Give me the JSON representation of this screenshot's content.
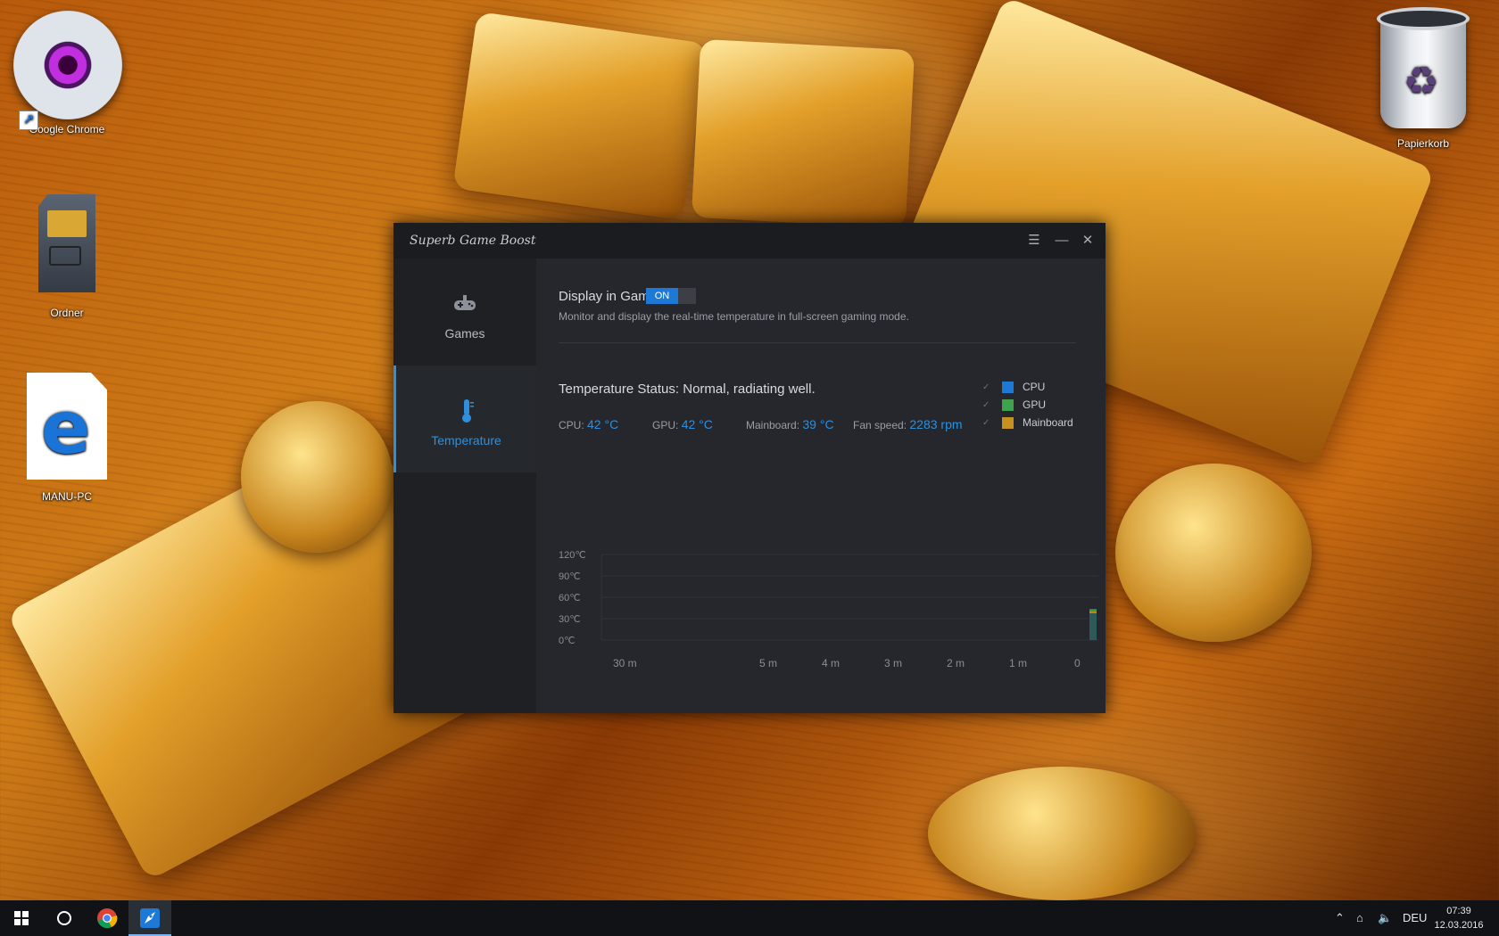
{
  "desktop": {
    "icons": [
      {
        "label": "Google Chrome"
      },
      {
        "label": "Ordner"
      },
      {
        "label": "MANU-PC"
      },
      {
        "label": "Papierkorb"
      }
    ]
  },
  "app": {
    "title": "Superb Game Boost",
    "nav": [
      {
        "label": "Games",
        "icon": "gamepad-icon"
      },
      {
        "label": "Temperature",
        "icon": "thermometer-icon"
      }
    ],
    "display_in_game": {
      "label": "Display in Game:",
      "toggle": "ON",
      "description": "Monitor and display the real-time temperature in full-screen gaming mode."
    },
    "status": "Temperature Status: Normal, radiating well.",
    "metrics": {
      "cpu_label": "CPU:",
      "cpu_value": "42 °C",
      "gpu_label": "GPU:",
      "gpu_value": "42 °C",
      "mb_label": "Mainboard:",
      "mb_value": "39 °C",
      "fan_label": "Fan speed:",
      "fan_value": "2283 rpm"
    },
    "legend": [
      {
        "name": "CPU",
        "color": "#1c7ad6"
      },
      {
        "name": "GPU",
        "color": "#3fa34d"
      },
      {
        "name": "Mainboard",
        "color": "#c8901e"
      }
    ]
  },
  "chart_data": {
    "type": "line",
    "y_ticks": [
      "120℃",
      "90℃",
      "60℃",
      "30℃",
      "0℃"
    ],
    "x_ticks": [
      "30 m",
      "5 m",
      "4 m",
      "3 m",
      "2 m",
      "1 m",
      "0"
    ],
    "ylim": [
      0,
      120
    ],
    "series": [
      {
        "name": "CPU",
        "values": [
          42
        ]
      },
      {
        "name": "GPU",
        "values": [
          42
        ]
      },
      {
        "name": "Mainboard",
        "values": [
          39
        ]
      }
    ],
    "grid": true
  },
  "taskbar": {
    "items": [
      "start-icon",
      "cortana-icon",
      "chrome-icon",
      "game-boost-icon"
    ],
    "language": "DEU",
    "time": "07:39",
    "date": "12.03.2016"
  },
  "colors": {
    "accent": "#2f8fdc",
    "window_bg": "#24262b"
  }
}
